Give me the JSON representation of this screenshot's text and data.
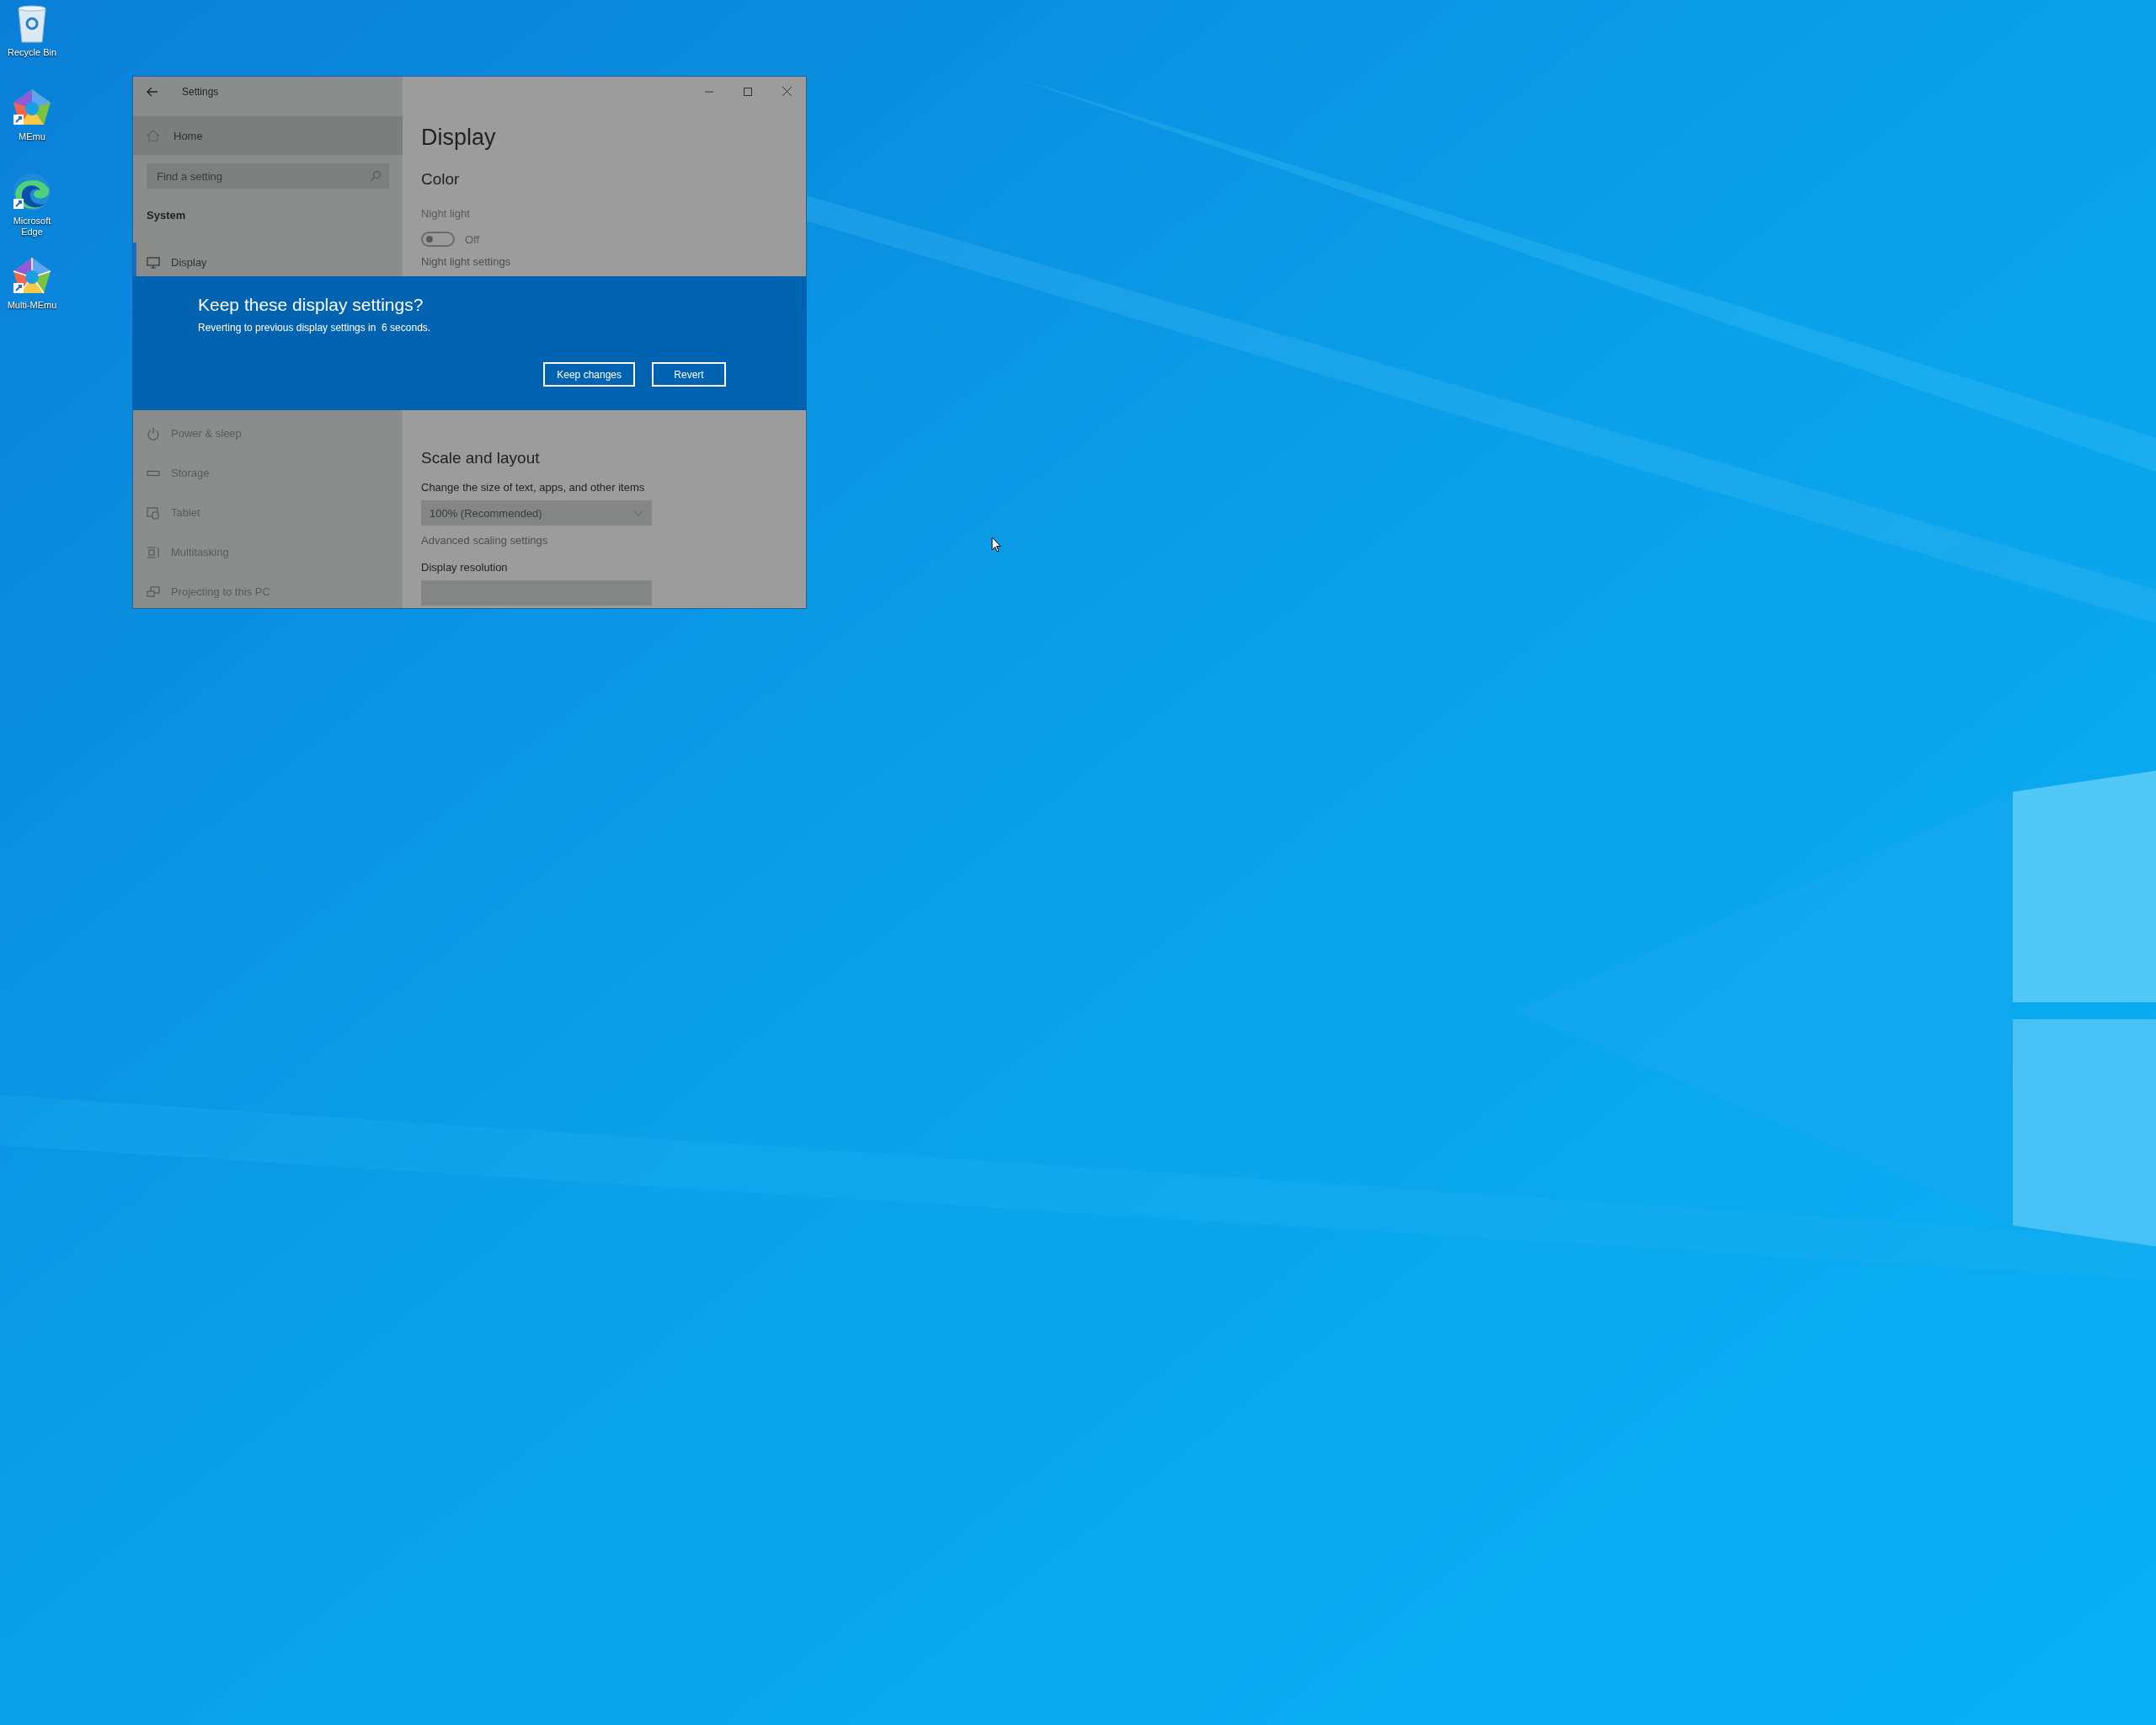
{
  "desktop_icons": [
    {
      "kind": "recycle",
      "label": "Recycle Bin"
    },
    {
      "kind": "memu",
      "label": "MEmu"
    },
    {
      "kind": "edge",
      "label": "Microsoft Edge"
    },
    {
      "kind": "multimemu",
      "label": "Multi-MEmu"
    }
  ],
  "window": {
    "title": "Settings",
    "sidebar": {
      "home": "Home",
      "search": {
        "placeholder": "Find a setting"
      },
      "section": "System",
      "items": [
        {
          "kind": "monitor",
          "label": "Display",
          "selected": true
        },
        {
          "kind": "power",
          "label": "Power & sleep",
          "selected": false
        },
        {
          "kind": "storage",
          "label": "Storage",
          "selected": false
        },
        {
          "kind": "tablet",
          "label": "Tablet",
          "selected": false
        },
        {
          "kind": "multitasking",
          "label": "Multitasking",
          "selected": false
        },
        {
          "kind": "projecting",
          "label": "Projecting to this PC",
          "selected": false
        }
      ]
    },
    "content": {
      "heading": "Display",
      "color_section": {
        "title": "Color",
        "night_light": {
          "label": "Night light",
          "on": false,
          "state_label": "Off"
        },
        "link": "Night light settings"
      },
      "scale_section": {
        "title": "Scale and layout",
        "size_label": "Change the size of text, apps, and other items",
        "size_value": "100% (Recommended)",
        "advanced_link": "Advanced scaling settings",
        "resolution_label": "Display resolution"
      }
    }
  },
  "dialog": {
    "title": "Keep these display settings?",
    "message": "Reverting to previous display settings in  6 seconds.",
    "buttons": [
      "Keep changes",
      "Revert"
    ]
  }
}
